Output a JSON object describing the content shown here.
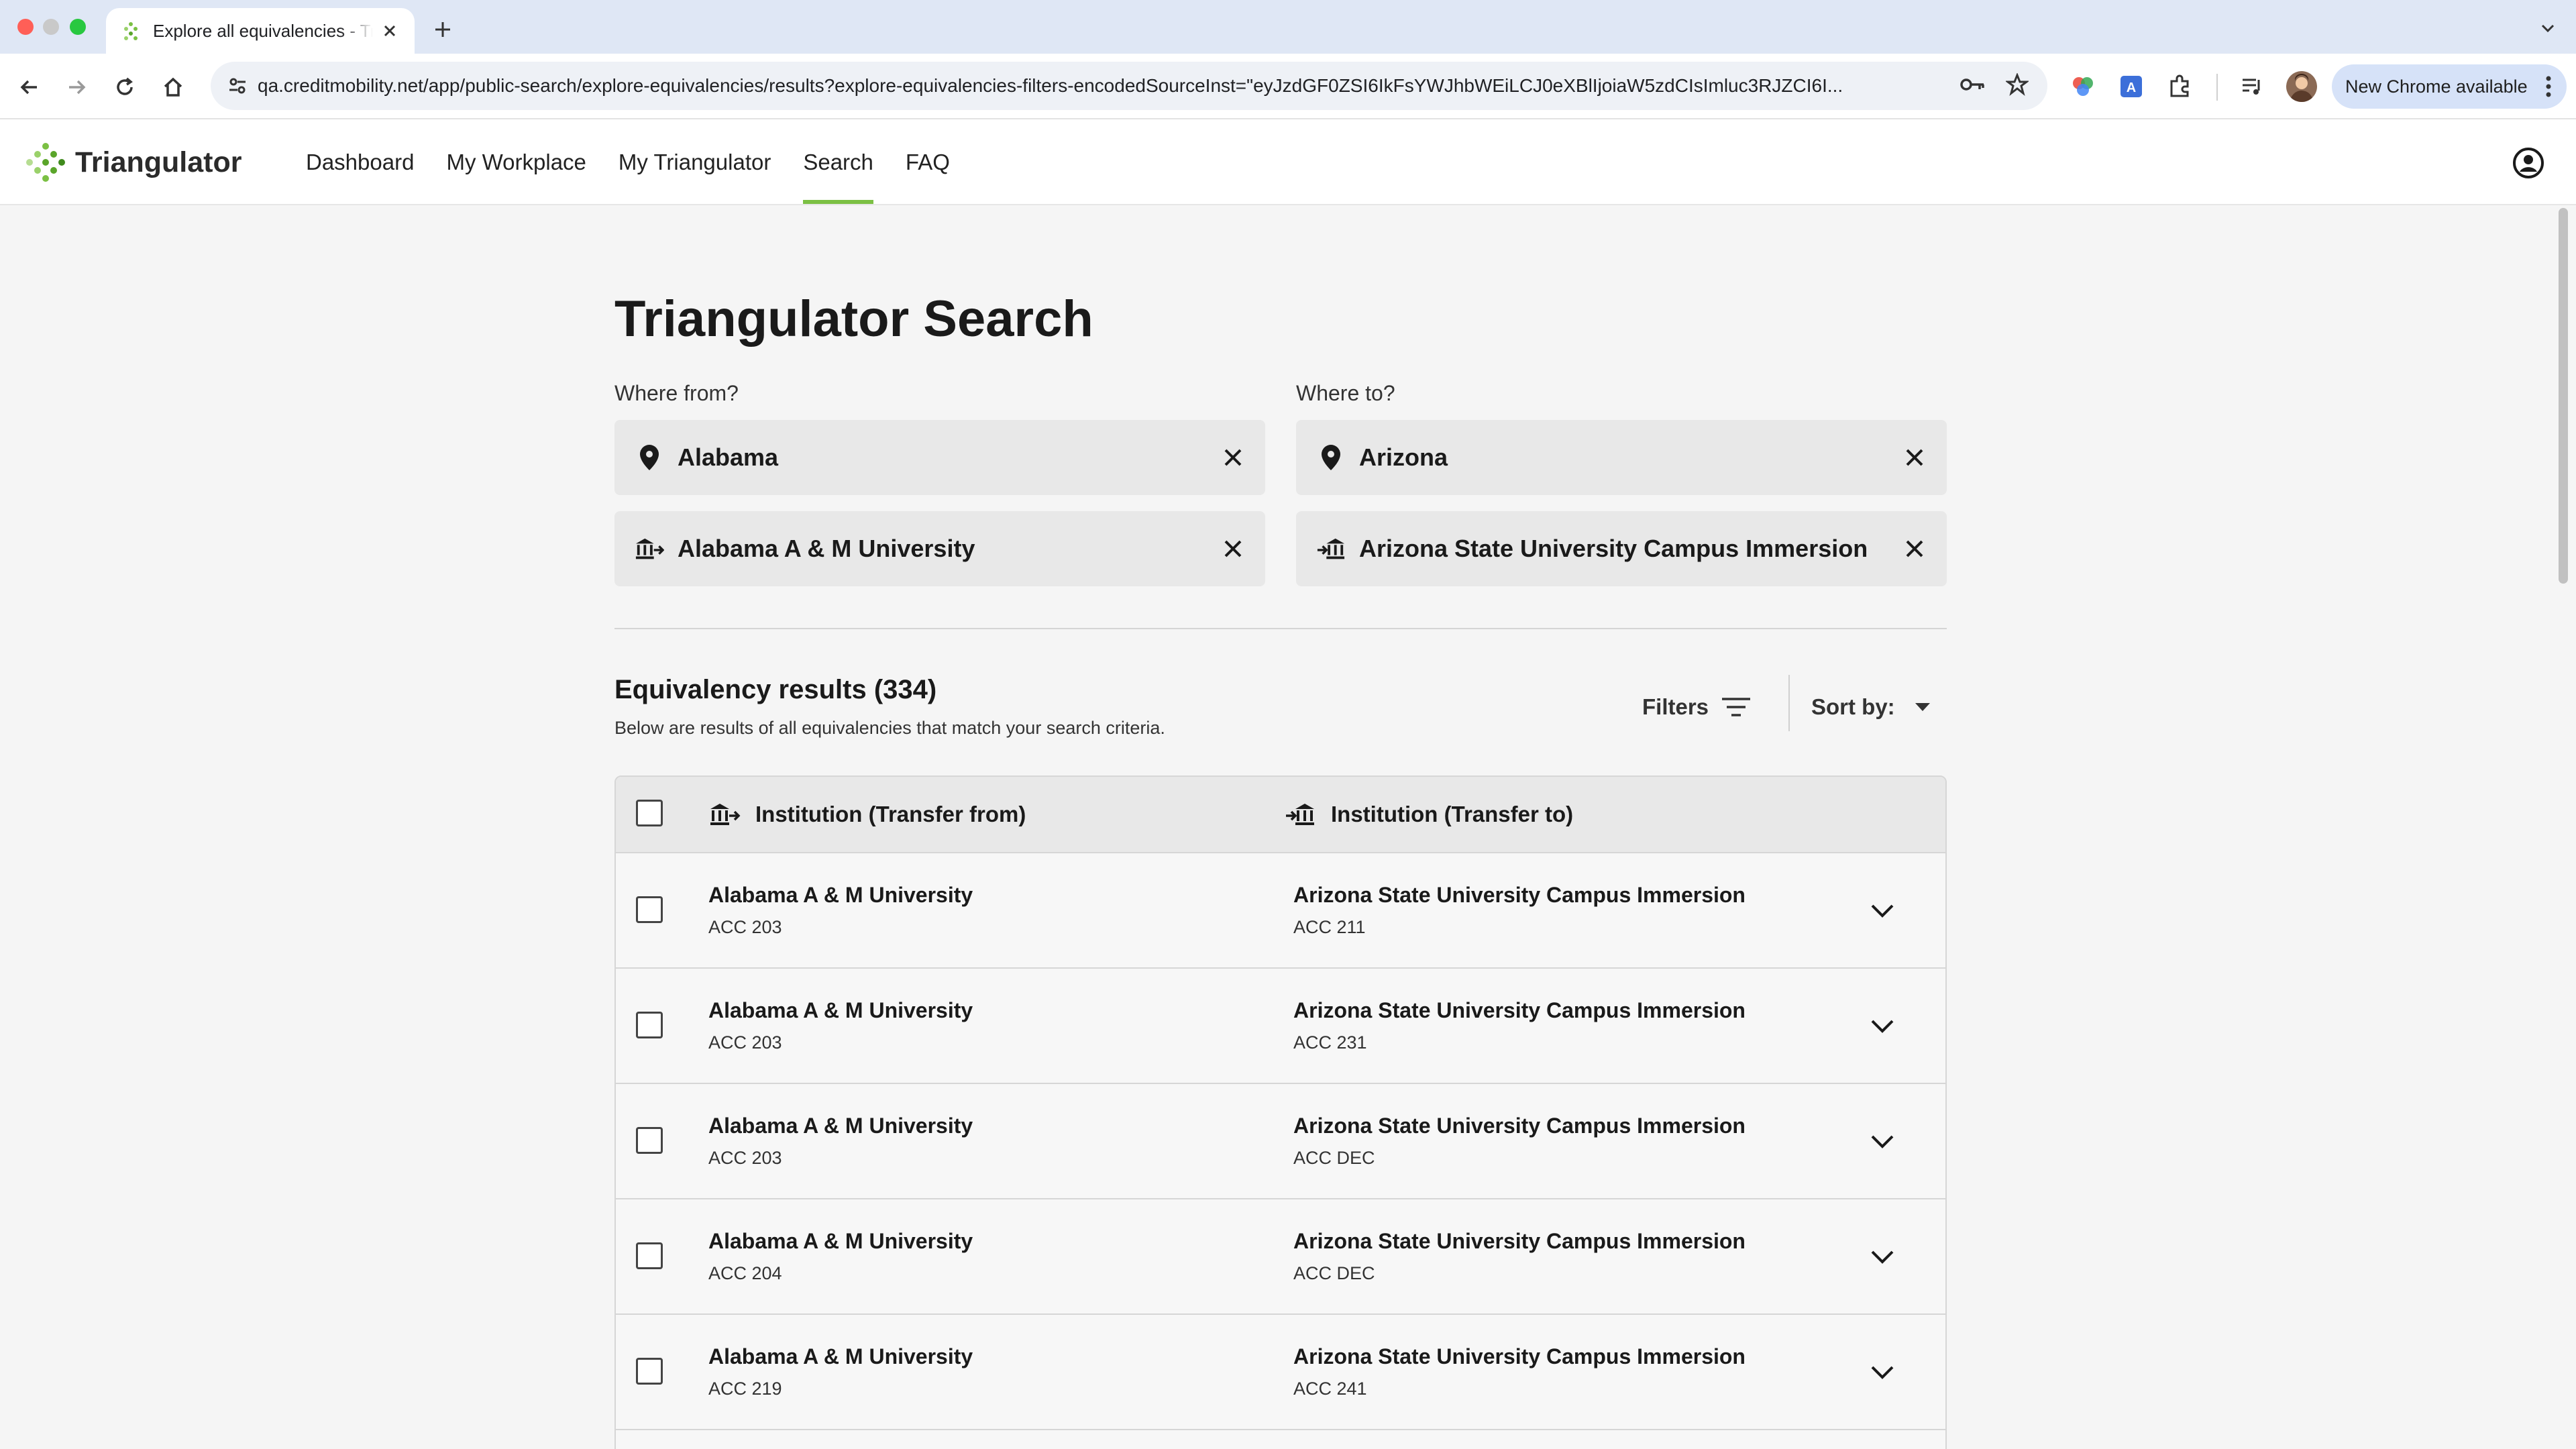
{
  "browser": {
    "tab_title": "Explore all equivalencies - Triangulator",
    "url": "qa.creditmobility.net/app/public-search/explore-equivalencies/results?explore-equivalencies-filters-encodedSourceInst=\"eyJzdGF0ZSI6IkFsYWJhbWEiLCJ0eXBlIjoiaW5zdCIsImluc3RJZCI6I...",
    "update_label": "New Chrome available"
  },
  "app": {
    "logo_text": "Triangulator",
    "nav": [
      {
        "label": "Dashboard"
      },
      {
        "label": "My Workplace"
      },
      {
        "label": "My Triangulator"
      },
      {
        "label": "Search",
        "active": true
      },
      {
        "label": "FAQ"
      }
    ]
  },
  "search": {
    "title": "Triangulator Search",
    "from_label": "Where from?",
    "to_label": "Where to?",
    "from_state": "Alabama",
    "to_state": "Arizona",
    "from_institution": "Alabama A & M University",
    "to_institution": "Arizona State University Campus Immersion"
  },
  "results": {
    "title": "Equivalency results (334)",
    "subtitle": "Below are results of all equivalencies that match your search criteria.",
    "filters_label": "Filters",
    "sort_label": "Sort by:",
    "col_from": "Institution (Transfer from)",
    "col_to": "Institution (Transfer to)",
    "rows": [
      {
        "from_inst": "Alabama A & M University",
        "from_code": "ACC 203",
        "to_inst": "Arizona State University Campus Immersion",
        "to_code": "ACC 211"
      },
      {
        "from_inst": "Alabama A & M University",
        "from_code": "ACC 203",
        "to_inst": "Arizona State University Campus Immersion",
        "to_code": "ACC 231"
      },
      {
        "from_inst": "Alabama A & M University",
        "from_code": "ACC 203",
        "to_inst": "Arizona State University Campus Immersion",
        "to_code": "ACC DEC"
      },
      {
        "from_inst": "Alabama A & M University",
        "from_code": "ACC 204",
        "to_inst": "Arizona State University Campus Immersion",
        "to_code": "ACC DEC"
      },
      {
        "from_inst": "Alabama A & M University",
        "from_code": "ACC 219",
        "to_inst": "Arizona State University Campus Immersion",
        "to_code": "ACC 241"
      }
    ]
  },
  "colors": {
    "accent_green": "#7bc043",
    "field_bg": "#e8e8e8"
  }
}
